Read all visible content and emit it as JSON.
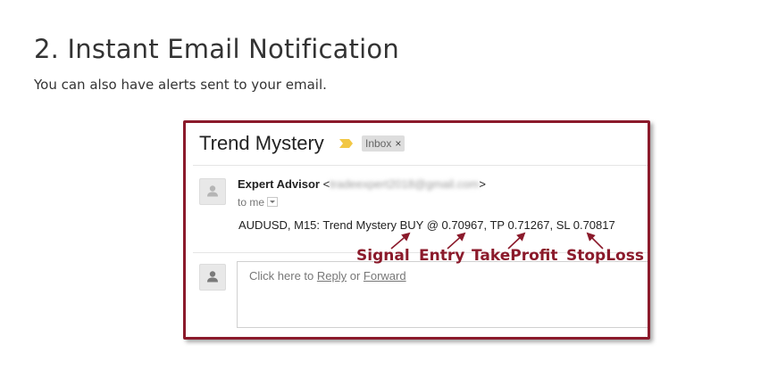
{
  "article": {
    "heading": "2. Instant Email Notification",
    "intro": "You can also have alerts sent to your email."
  },
  "email": {
    "subject": "Trend Mystery",
    "label_chip": "Inbox",
    "label_close": "×",
    "sender_name": "Expert Advisor",
    "sender_email_open": "<",
    "sender_email_blurred": "tradeexpert2018@gmail.com",
    "sender_email_close": ">",
    "recipient": "to me",
    "body": "AUDUSD, M15: Trend Mystery BUY @ 0.70967, TP 0.71267, SL 0.70817",
    "reply": {
      "prefix": "Click here to ",
      "reply_link": "Reply",
      "middle": " or ",
      "forward_link": "Forward"
    }
  },
  "annotations": {
    "signal": "Signal",
    "entry": "Entry",
    "takeprofit": "TakeProfit",
    "stoploss": "StopLoss",
    "color": "#8b1a2b"
  },
  "colors": {
    "frame": "#8b1a2b",
    "important_marker": "#f2c744"
  },
  "icons": {
    "important": "important-marker-icon",
    "avatar": "person-icon"
  }
}
